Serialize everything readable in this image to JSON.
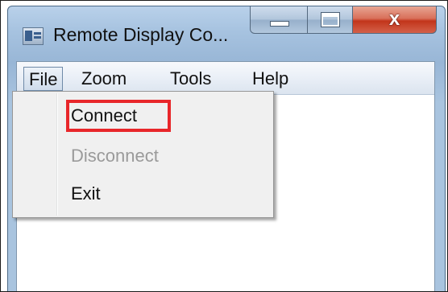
{
  "window": {
    "title": "Remote Display Co..."
  },
  "caption_buttons": {
    "close_glyph": "x"
  },
  "menubar": {
    "items": [
      "File",
      "Zoom",
      "Tools",
      "Help"
    ]
  },
  "file_menu": {
    "items": [
      {
        "label": "Connect",
        "enabled": true,
        "highlighted": true
      },
      {
        "label": "Disconnect",
        "enabled": false
      },
      {
        "label": "Exit",
        "enabled": true
      }
    ]
  },
  "colors": {
    "highlight_border": "#e8262a",
    "disabled_text": "#9a9a9a",
    "close_button": "#c2351b"
  }
}
